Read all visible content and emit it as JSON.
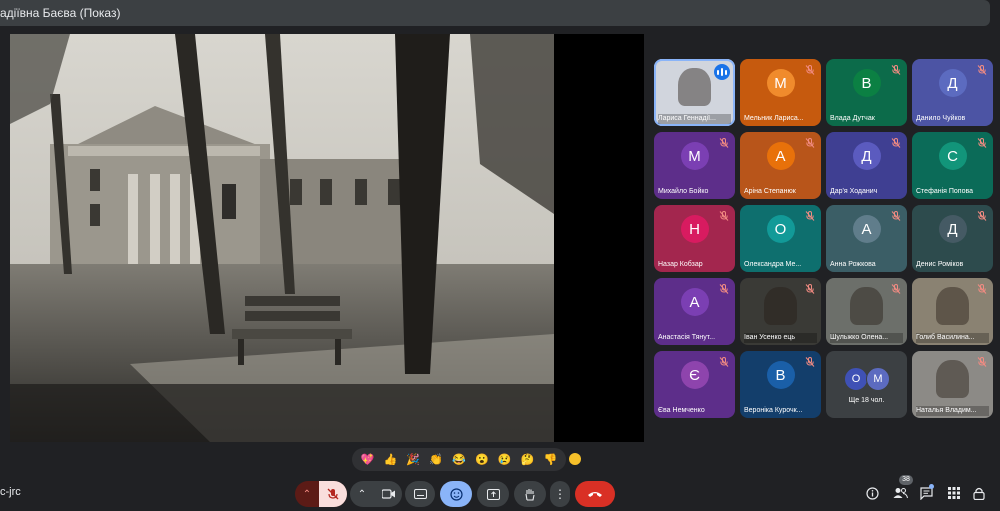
{
  "window": {
    "title": "адіївна Баєва (Показ)"
  },
  "meeting_code": "c-jrc",
  "participant_count": "38",
  "colors": {
    "background": "#202124",
    "end_call": "#d93025",
    "accent": "#8ab4f8",
    "mic_off": "#f28b82"
  },
  "participants": [
    {
      "name": "Лариса Геннадії...",
      "initial": "",
      "color": "#d1d5dd",
      "photo": true,
      "speaking": true
    },
    {
      "name": "Мельник Лариса...",
      "initial": "М",
      "color": "#c65a0e",
      "avatar": "#f08b2c"
    },
    {
      "name": "Влада Дутчак",
      "initial": "В",
      "color": "#0c6b4a",
      "avatar": "#0b8043"
    },
    {
      "name": "Данило Чуйков",
      "initial": "Д",
      "color": "#4c54a4",
      "avatar": "#5c6bc0"
    },
    {
      "name": "Михайло Бойко",
      "initial": "М",
      "color": "#5d2e8a",
      "avatar": "#7b3fb3"
    },
    {
      "name": "Аріна Степанюк",
      "initial": "А",
      "color": "#b8551a",
      "avatar": "#e8710a"
    },
    {
      "name": "Дар'я Ходанич",
      "initial": "Д",
      "color": "#3f3f92",
      "avatar": "#5b5bbf"
    },
    {
      "name": "Стефанія Попова",
      "initial": "С",
      "color": "#0b6b58",
      "avatar": "#12957a"
    },
    {
      "name": "Назар Кобзар",
      "initial": "Н",
      "color": "#a3264e",
      "avatar": "#d81b60"
    },
    {
      "name": "Олександра Ме...",
      "initial": "О",
      "color": "#0e6f6e",
      "avatar": "#129a98"
    },
    {
      "name": "Анна Рожкова",
      "initial": "А",
      "color": "#3b5e66",
      "avatar": "#607d8b"
    },
    {
      "name": "Денис Роміков",
      "initial": "Д",
      "color": "#2d4b4d",
      "avatar": "#455a64"
    },
    {
      "name": "Анастасія Тянут...",
      "initial": "А",
      "color": "#5d2e8a",
      "avatar": "#7b3fb3"
    },
    {
      "name": "Іван Усенко ець",
      "initial": "",
      "color": "#3a3a36",
      "photo": true
    },
    {
      "name": "Шульжко Олена...",
      "initial": "",
      "color": "#6c6f6a",
      "photo": true
    },
    {
      "name": "Голиб Василина...",
      "initial": "",
      "color": "#8a8272",
      "photo": true
    },
    {
      "name": "Єва Немченко",
      "initial": "Є",
      "color": "#5d2e8a",
      "avatar": "#8e44ad"
    },
    {
      "name": "Вероніка Курочк...",
      "initial": "В",
      "color": "#133e6b",
      "avatar": "#1a5fa8"
    },
    {
      "name": "Ще 18 чол.",
      "initial": "",
      "color": "#3c4043",
      "more": true,
      "initials": [
        "О",
        "М"
      ]
    },
    {
      "name": "Наталья Владим...",
      "initial": "",
      "color": "#8c8a86",
      "photo": true
    }
  ],
  "reactions": [
    "💖",
    "👍",
    "🎉",
    "👏",
    "😂",
    "😮",
    "😢",
    "🤔",
    "👎"
  ],
  "toolbar": [
    {
      "name": "mic-chevron-button",
      "icon": "chevron-up-icon"
    },
    {
      "name": "mic-button",
      "icon": "mic-off-icon"
    },
    {
      "name": "camera-chevron-button",
      "icon": "chevron-up-icon"
    },
    {
      "name": "camera-button",
      "icon": "camera-icon"
    },
    {
      "name": "captions-button",
      "icon": "captions-icon"
    },
    {
      "name": "emoji-button",
      "icon": "emoji-icon"
    },
    {
      "name": "present-button",
      "icon": "present-icon"
    },
    {
      "name": "raise-hand-button",
      "icon": "hand-icon"
    },
    {
      "name": "more-options-button",
      "icon": "more-vert-icon"
    },
    {
      "name": "end-call-button",
      "icon": "end-call-icon"
    }
  ]
}
